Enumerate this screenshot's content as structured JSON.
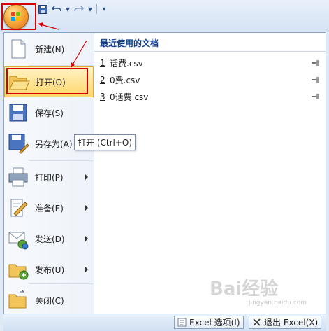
{
  "quick_access": {
    "save_icon": "save-icon",
    "undo_icon": "undo-icon",
    "redo_icon": "redo-icon",
    "customize_icon": "customize-icon"
  },
  "menu": {
    "items": [
      {
        "label": "新建(N)",
        "icon": "new-document-icon"
      },
      {
        "label": "打开(O)",
        "icon": "open-folder-icon"
      },
      {
        "label": "保存(S)",
        "icon": "save-icon"
      },
      {
        "label": "另存为(A)",
        "icon": "save-as-icon"
      },
      {
        "label": "打印(P)",
        "icon": "print-icon"
      },
      {
        "label": "准备(E)",
        "icon": "prepare-icon"
      },
      {
        "label": "发送(D)",
        "icon": "send-icon"
      },
      {
        "label": "发布(U)",
        "icon": "publish-icon"
      },
      {
        "label": "关闭(C)",
        "icon": "close-folder-icon"
      }
    ]
  },
  "recent": {
    "header": "最近使用的文档",
    "items": [
      {
        "num": "1",
        "name": "话费.csv"
      },
      {
        "num": "2",
        "name": "0费.csv"
      },
      {
        "num": "3",
        "name": "0话费.csv"
      }
    ]
  },
  "tooltip": "打开 (Ctrl+O)",
  "bottom": {
    "options_label": "Excel 选项(I)",
    "exit_label": "退出 Excel(X)"
  },
  "watermark": {
    "text": "Bai经验",
    "sub": "jingyan.baidu.com"
  },
  "colors": {
    "annotation": "#d60000",
    "highlight": "#ffd66a"
  }
}
